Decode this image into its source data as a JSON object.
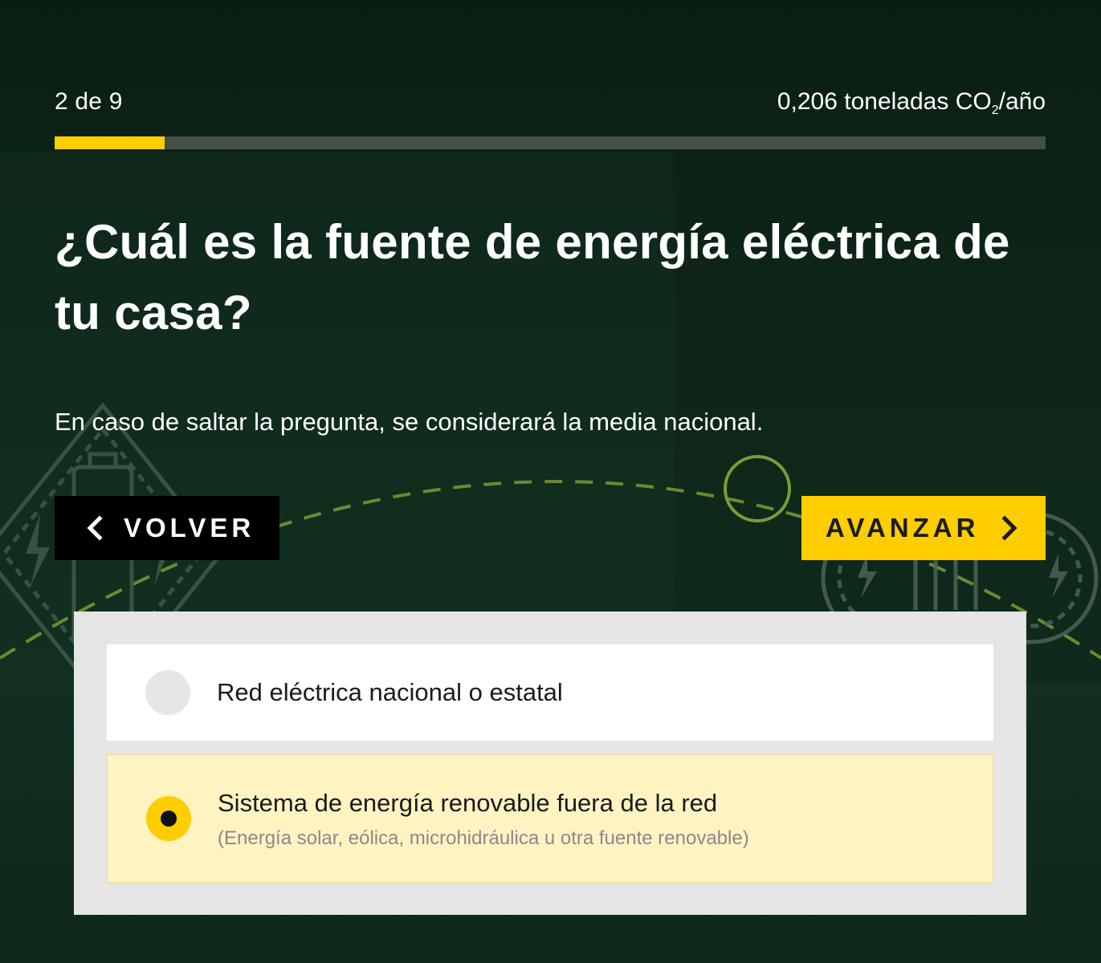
{
  "progress": {
    "step_label": "2 de 9",
    "step_current": 2,
    "step_total": 9,
    "emissions_value": "0,206 toneladas CO",
    "emissions_sub": "2",
    "emissions_unit": "/año"
  },
  "question": {
    "title": "¿Cuál es la fuente de energía eléctrica de tu casa?",
    "hint": "En caso de saltar la pregunta, se considerará la media nacional."
  },
  "nav": {
    "back_label": "VOLVER",
    "next_label": "AVANZAR"
  },
  "options": [
    {
      "label": "Red eléctrica nacional o estatal",
      "selected": false
    },
    {
      "label": "Sistema de energía renovable fuera de la red",
      "sublabel": "(Energía solar, eólica, microhidráulica u otra fuente renovable)",
      "selected": true
    }
  ],
  "colors": {
    "accent": "#ffcd00",
    "background": "#0f2819",
    "selected_option_bg": "#fff3c2",
    "panel_bg": "#e5e5e5"
  }
}
